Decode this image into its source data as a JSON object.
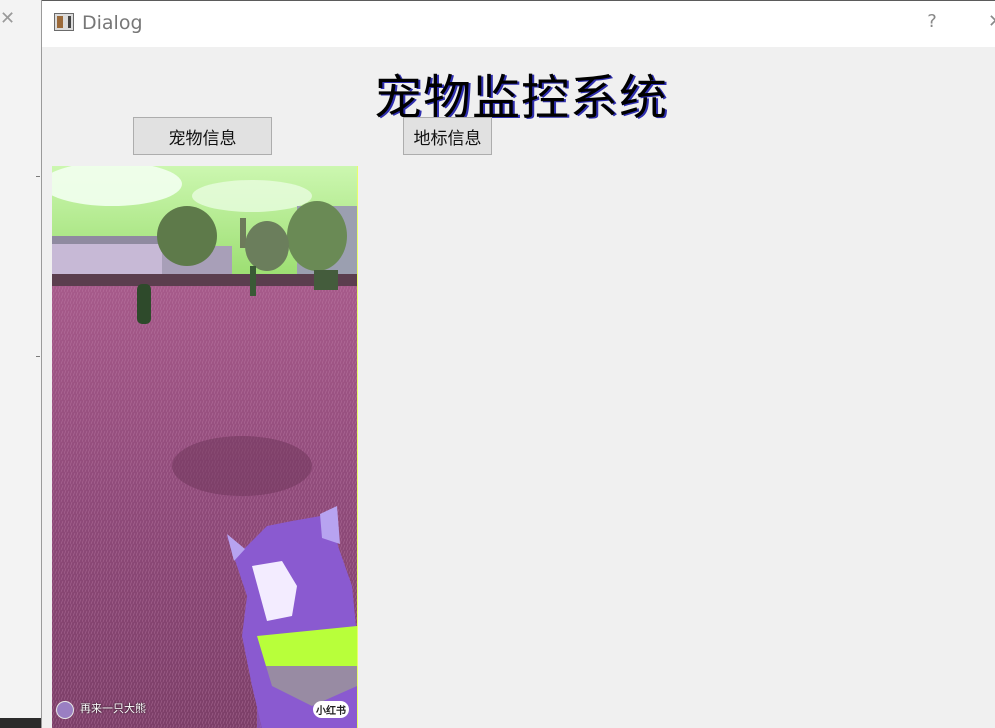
{
  "window": {
    "title": "Dialog",
    "help_label": "?",
    "close_label": "✕"
  },
  "background_app": {
    "close_label": "✕"
  },
  "main": {
    "heading": "宠物监控系统",
    "buttons": {
      "pet_info": "宠物信息",
      "landmark_info": "地标信息"
    }
  },
  "video_frame": {
    "caption": "再来一只大熊",
    "watermark": "小红书"
  },
  "icons": {
    "app": "window-app-icon",
    "help": "help-icon",
    "close": "close-icon"
  },
  "colors": {
    "grass": "#9c5080",
    "sky": "#a6e87a",
    "dog": "#8a5ad0",
    "harness": "#b8ff3a"
  }
}
